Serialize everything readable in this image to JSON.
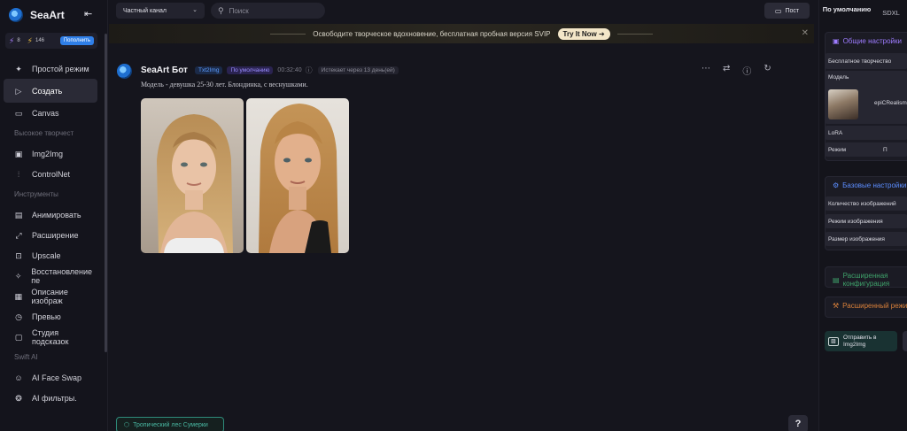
{
  "brand": {
    "name": "SeaArt"
  },
  "credits": {
    "stamina": "8",
    "coins": "146",
    "topup_label": "Пополнить"
  },
  "sidebar": {
    "items": [
      {
        "id": "simple",
        "label": "Простой режим",
        "icon": "sparkle-icon"
      },
      {
        "id": "create",
        "label": "Создать",
        "icon": "play-icon",
        "active": true
      },
      {
        "id": "canvas",
        "label": "Canvas",
        "icon": "canvas-icon"
      }
    ],
    "section_hq": "Высокое творчест",
    "hq_items": [
      {
        "id": "img2img",
        "label": "Img2Img",
        "icon": "image-icon"
      },
      {
        "id": "controlnet",
        "label": "ControlNet",
        "icon": "sliders-icon"
      }
    ],
    "section_tools": "Инструменты",
    "tool_items": [
      {
        "id": "animate",
        "label": "Анимировать",
        "icon": "film-icon"
      },
      {
        "id": "expand",
        "label": "Расширение",
        "icon": "expand-icon"
      },
      {
        "id": "upscale",
        "label": "Upscale",
        "icon": "upscale-icon"
      },
      {
        "id": "restore",
        "label": "Восстановление пе",
        "icon": "restore-icon"
      },
      {
        "id": "describe",
        "label": "Описание изображ",
        "icon": "describe-icon"
      },
      {
        "id": "preview",
        "label": "Превью",
        "icon": "preview-icon"
      },
      {
        "id": "prompt_studio",
        "label": "Студия подсказок",
        "icon": "studio-icon"
      }
    ],
    "section_swift": "Swift AI",
    "swift_items": [
      {
        "id": "faceswap",
        "label": "AI Face Swap",
        "icon": "faceswap-icon"
      },
      {
        "id": "filters",
        "label": "AI фильтры.",
        "icon": "filters-icon"
      }
    ]
  },
  "topbar": {
    "channel": "Частный канал",
    "search_placeholder": "Поиск",
    "post_label": "Пост"
  },
  "promo": {
    "text": "Освободите творческое вдохновение, бесплатная пробная версия SVIP",
    "cta": "Try It Now"
  },
  "message": {
    "bot_name": "SeaArt Бот",
    "tag_mode": "Txt2Img",
    "tag_default": "По умолчанию",
    "time": "00:32:40",
    "expire": "Истекает через 13 день(ей)",
    "prompt": "Модель - девушка 25-30 лет. Блондинка, с веснушками."
  },
  "bottom_chip": "Тропический лес Сумерки",
  "help_label": "?",
  "right_panel": {
    "tab_default": "По умолчанию",
    "tab_sdxl": "SDXL",
    "general_title": "Общие настройки",
    "free_creation": "Бесплатное творчество",
    "model_label": "Модель",
    "model_name": "epiCRealism",
    "lora_label": "LoRA",
    "mode_label": "Режим",
    "mode_value": "П",
    "basic_title": "Базовые настройки",
    "count_label": "Количество изображений",
    "image_mode_label": "Режим изображения",
    "size_label": "Размер изображения",
    "advanced_config": "Расширенная конфигурация",
    "advanced_mode": "Расширенный режим",
    "send_label_1": "Отправить в",
    "send_label_2": "Img2Img"
  }
}
